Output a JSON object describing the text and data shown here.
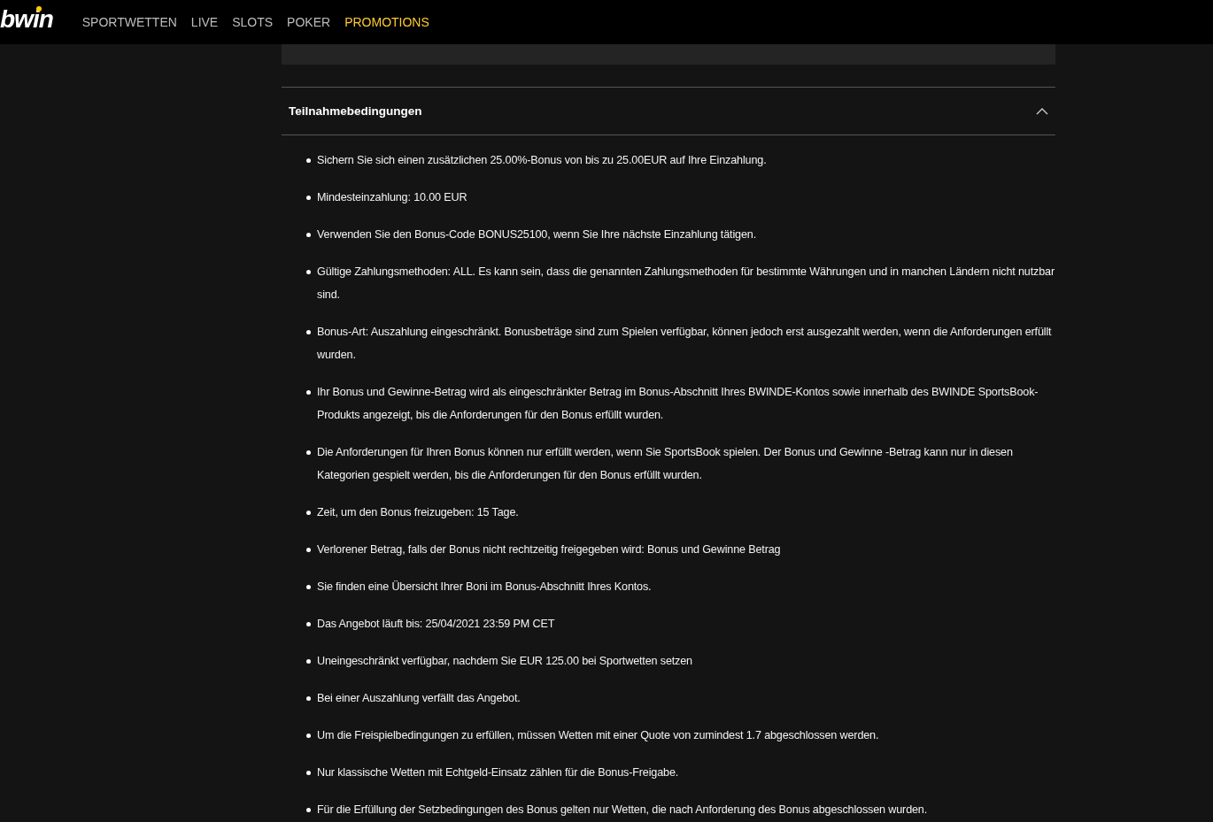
{
  "header": {
    "logo": "bwin",
    "nav": [
      {
        "label": "SPORTWETTEN",
        "selected": false
      },
      {
        "label": "LIVE",
        "selected": false
      },
      {
        "label": "SLOTS",
        "selected": false
      },
      {
        "label": "POKER",
        "selected": false
      },
      {
        "label": "PROMOTIONS",
        "selected": true
      }
    ]
  },
  "section": {
    "title": "Teilnahmebedingungen",
    "expanded": true,
    "items": [
      "Sichern Sie sich einen zusätzlichen 25.00%-Bonus von bis zu 25.00EUR auf Ihre Einzahlung.",
      "Mindesteinzahlung: 10.00 EUR",
      "Verwenden Sie den Bonus-Code BONUS25100, wenn Sie Ihre nächste Einzahlung tätigen.",
      "Gültige Zahlungsmethoden: ALL. Es kann sein, dass die genannten Zahlungsmethoden für bestimmte Währungen und in manchen Ländern nicht nutzbar sind.",
      "Bonus-Art: Auszahlung eingeschränkt. Bonusbeträge sind zum Spielen verfügbar, können jedoch erst ausgezahlt werden, wenn die Anforderungen erfüllt wurden.",
      "Ihr Bonus und Gewinne-Betrag wird als eingeschränkter Betrag im Bonus-Abschnitt Ihres BWINDE-Kontos sowie innerhalb des BWINDE SportsBook-Produkts angezeigt, bis die Anforderungen für den Bonus erfüllt wurden.",
      "Die Anforderungen für Ihren Bonus können nur erfüllt werden, wenn Sie SportsBook spielen. Der Bonus und Gewinne -Betrag kann nur in diesen Kategorien gespielt werden, bis die Anforderungen für den Bonus erfüllt wurden.",
      "Zeit, um den Bonus freizugeben: 15 Tage.",
      "Verlorener Betrag, falls der Bonus nicht rechtzeitig freigegeben wird: Bonus und Gewinne Betrag",
      "Sie finden eine Übersicht Ihrer Boni im Bonus-Abschnitt Ihres Kontos.",
      "Das Angebot läuft bis: 25/04/2021 23:59 PM CET",
      "Uneingeschränkt verfügbar, nachdem Sie EUR 125.00 bei Sportwetten setzen",
      "Bei einer Auszahlung verfällt das Angebot.",
      "Um die Freispielbedingungen zu erfüllen, müssen Wetten mit einer Quote von zumindest 1.7 abgeschlossen werden.",
      "Nur klassische Wetten mit Echtgeld-Einsatz zählen für die Bonus-Freigabe.",
      "Für die Erfüllung der Setzbedingungen des Bonus gelten nur Wetten, die nach Anforderung des Bonus abgeschlossen wurden."
    ]
  }
}
